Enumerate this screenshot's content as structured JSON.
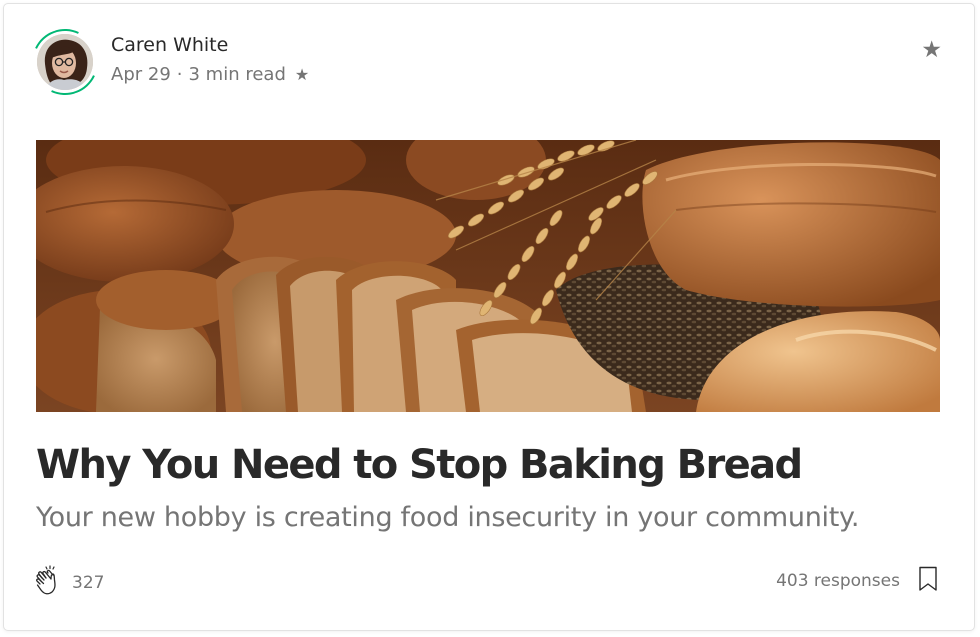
{
  "author": {
    "name": "Caren White",
    "date": "Apr 29",
    "separator": "·",
    "read_time": "3 min read",
    "member_star": "★"
  },
  "header": {
    "bookmark_star": "★"
  },
  "article": {
    "title": "Why You Need to Stop Baking Bread",
    "subtitle": "Your new hobby is creating food insecurity in your community."
  },
  "footer": {
    "claps": "327",
    "responses": "403 responses"
  },
  "icons": {
    "clap": "clap-icon",
    "bookmark": "bookmark-icon",
    "star": "star-icon"
  },
  "colors": {
    "accent_ring": "#02b875",
    "text_primary": "#292929",
    "text_secondary": "#757575"
  }
}
